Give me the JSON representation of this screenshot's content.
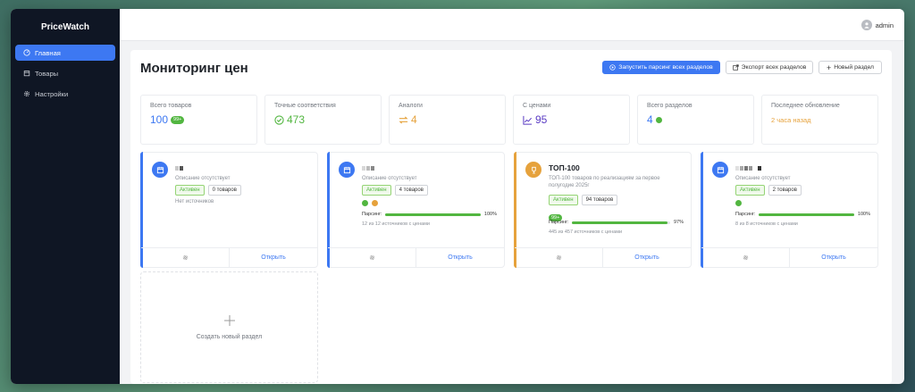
{
  "app": {
    "brand": "PriceWatch"
  },
  "sidebar": {
    "items": [
      {
        "label": "Главная",
        "icon": "dashboard-icon",
        "active": true
      },
      {
        "label": "Товары",
        "icon": "box-icon",
        "active": false
      },
      {
        "label": "Настройки",
        "icon": "gear-icon",
        "active": false
      }
    ]
  },
  "topbar": {
    "user": "admin"
  },
  "page": {
    "title": "Мониторинг цен",
    "buttons": {
      "run_all": "Запустить парсинг всех разделов",
      "export": "Экспорт всех разделов",
      "new": "Новый раздел"
    }
  },
  "stats": [
    {
      "label": "Всего товаров",
      "value": "100",
      "badge": "99+",
      "color": "#3d78f2"
    },
    {
      "label": "Точные соответствия",
      "value": "473",
      "color": "#52b640"
    },
    {
      "label": "Аналоги",
      "value": "4",
      "color": "#e6a23c"
    },
    {
      "label": "С ценами",
      "value": "95",
      "color": "#5b3cc4"
    },
    {
      "label": "Всего разделов",
      "value": "4",
      "color": "#3d78f2"
    },
    {
      "label": "Последнее обновление",
      "value": "2 часа назад",
      "color": "#e6a23c"
    }
  ],
  "cards": [
    {
      "title": "",
      "desc": "Описание отсутствует",
      "status": "Активен",
      "count": "0 товаров",
      "note": "Нет источников",
      "accent": "#3d78f2",
      "open": "Открыть"
    },
    {
      "title": "",
      "desc": "Описание отсутствует",
      "status": "Активен",
      "count": "4 товаров",
      "parsing_label": "Парсинг:",
      "parsing_pct": "100%",
      "parsing_value": 100,
      "sources": "12 из 12 источников с ценами",
      "accent": "#3d78f2",
      "open": "Открыть"
    },
    {
      "title": "ТОП-100",
      "desc": "ТОП-100 товаров по реализациям за первое полугодие 2025г",
      "status": "Активен",
      "count": "94 товаров",
      "badge": "99+",
      "parsing_label": "Парсинг:",
      "parsing_pct": "97%",
      "parsing_value": 97,
      "sources": "445 из 457 источников с ценами",
      "accent": "#e6a23c",
      "open": "Открыть"
    },
    {
      "title": "",
      "desc": "Описание отсутствует",
      "status": "Активен",
      "count": "2 товаров",
      "parsing_label": "Парсинг:",
      "parsing_pct": "100%",
      "parsing_value": 100,
      "sources": "8 из 8 источников с ценами",
      "accent": "#3d78f2",
      "open": "Открыть"
    }
  ],
  "create": {
    "label": "Создать новый раздел"
  }
}
